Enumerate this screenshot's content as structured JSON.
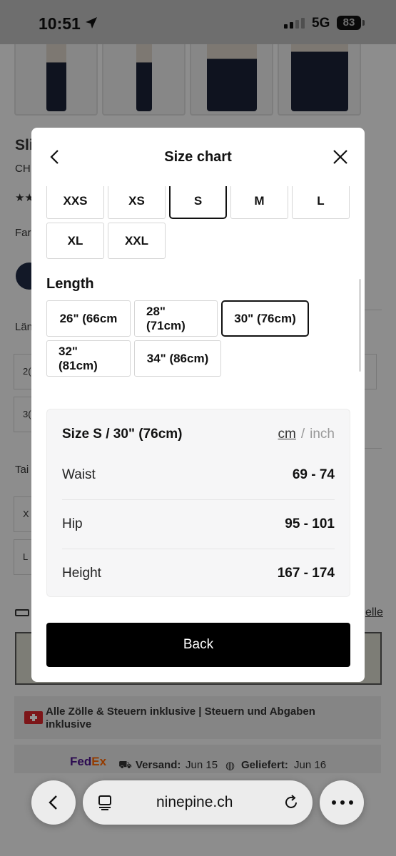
{
  "status_bar": {
    "time": "10:51",
    "network": "5G",
    "battery": "83"
  },
  "background_page": {
    "title_partial": "Sli",
    "subtitle_partial": "CH",
    "rating_partial": "★★",
    "color_label_partial": "Far",
    "length_label_partial": "Län",
    "length_opt1_partial": "2(",
    "length_opt2_partial": "3(",
    "waist_label_partial": "Tai",
    "waist_opt1_partial": "X",
    "waist_opt2_partial": "L",
    "size_link_partial": "elle",
    "duty_text": "Alle Zölle & Steuern inklusive | Steuern und Abgaben inklusive",
    "shipping": {
      "carrier_fed": "Fed",
      "carrier_ex": "Ex",
      "dispatch_label": "Versand:",
      "dispatch_date": "Jun 15",
      "delivered_label": "Geliefert:",
      "delivered_date": "Jun 16"
    }
  },
  "modal": {
    "title": "Size chart",
    "sizes": [
      "XXS",
      "XS",
      "S",
      "M",
      "L",
      "XL",
      "XXL"
    ],
    "selected_size": "S",
    "length_label": "Length",
    "lengths": [
      "26\" (66cm",
      "28\" (71cm)",
      "30\" (76cm)",
      "32\" (81cm)",
      "34\" (86cm)"
    ],
    "selected_length": "30\" (76cm)",
    "card": {
      "title": "Size S / 30\" (76cm)",
      "unit_cm": "cm",
      "unit_separator": "/",
      "unit_inch": "inch",
      "rows": [
        {
          "label": "Waist",
          "value": "69 - 74"
        },
        {
          "label": "Hip",
          "value": "95 - 101"
        },
        {
          "label": "Height",
          "value": "167 - 174"
        }
      ]
    },
    "back_button": "Back"
  },
  "browser": {
    "url": "ninepine.ch"
  }
}
